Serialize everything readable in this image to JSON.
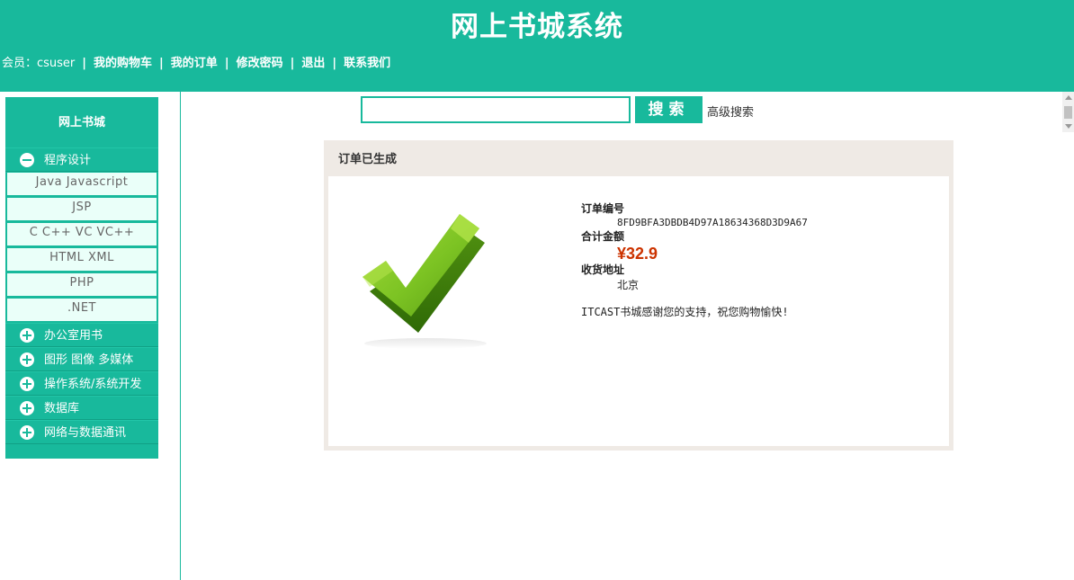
{
  "header": {
    "title": "网上书城系统",
    "member_label": "会员：csuser",
    "separator": "|",
    "nav_links": [
      "我的购物车",
      "我的订单",
      "修改密码",
      "退出",
      "联系我们"
    ]
  },
  "sidebar": {
    "title": "网上书城",
    "categories": [
      {
        "label": "程序设计",
        "expanded": true,
        "icon": "minus-icon",
        "items": [
          "Java Javascript",
          "JSP",
          "C C++ VC VC++",
          "HTML XML",
          "PHP",
          ".NET"
        ]
      },
      {
        "label": "办公室用书",
        "expanded": false,
        "icon": "plus-icon"
      },
      {
        "label": "图形 图像 多媒体",
        "expanded": false,
        "icon": "plus-icon"
      },
      {
        "label": "操作系统/系统开发",
        "expanded": false,
        "icon": "plus-icon"
      },
      {
        "label": "数据库",
        "expanded": false,
        "icon": "plus-icon"
      },
      {
        "label": "网络与数据通讯",
        "expanded": false,
        "icon": "plus-icon"
      }
    ]
  },
  "search": {
    "value": "",
    "button_label": "搜索",
    "advanced_label": "高级搜索"
  },
  "order": {
    "panel_title": "订单已生成",
    "id_label": "订单编号",
    "id_value": "8FD9BFA3DBDB4D97A18634368D3D9A67",
    "total_label": "合计金额",
    "total_value": "¥32.9",
    "address_label": "收货地址",
    "address_value": "北京",
    "thanks": "ITCAST书城感谢您的支持，祝您购物愉快!",
    "icon": "checkmark-icon"
  },
  "colors": {
    "brand": "#18b99c",
    "price": "#cc3300",
    "panel_bg": "#efeae5",
    "submenu_bg": "#eafff9"
  }
}
